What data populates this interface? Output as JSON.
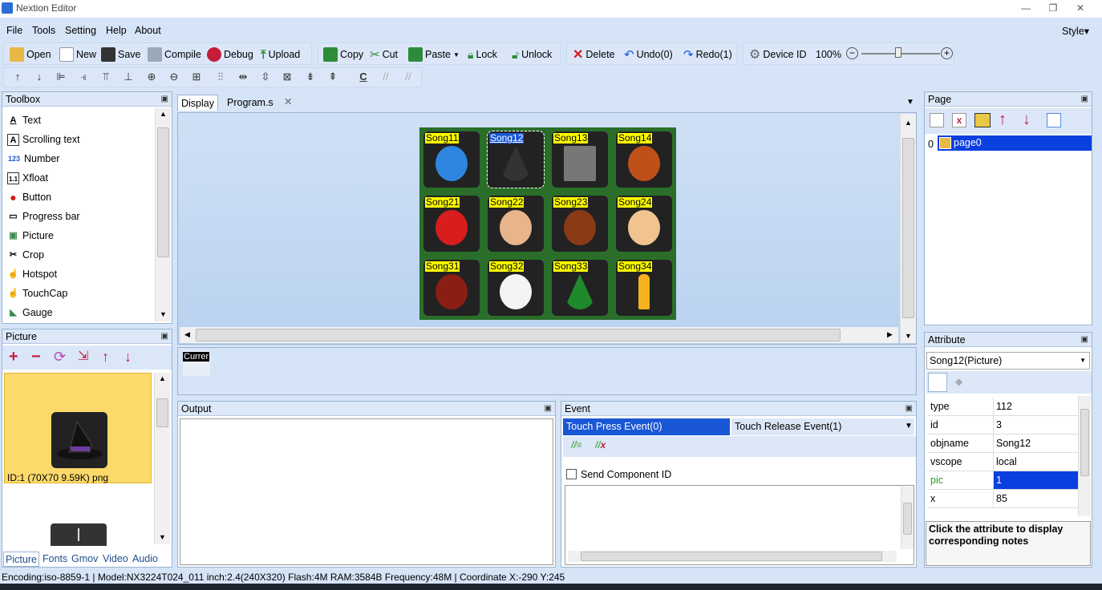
{
  "window": {
    "title": "Nextion Editor",
    "min": "—",
    "max": "❐",
    "close": "✕"
  },
  "menu": {
    "items": [
      "File",
      "Tools",
      "Setting",
      "Help",
      "About"
    ],
    "style": "Style▾"
  },
  "toolbar": {
    "open": "Open",
    "new": "New",
    "save": "Save",
    "compile": "Compile",
    "debug": "Debug",
    "upload": "Upload",
    "copy": "Copy",
    "cut": "Cut",
    "paste": "Paste",
    "lock": "Lock",
    "unlock": "Unlock",
    "delete": "Delete",
    "undo": "Undo(0)",
    "redo": "Redo(1)",
    "device_id": "Device ID",
    "zoom": "100%"
  },
  "toolbox": {
    "title": "Toolbox",
    "items": [
      {
        "label": "Text",
        "icon": "A"
      },
      {
        "label": "Scrolling text",
        "icon": "A"
      },
      {
        "label": "Number",
        "icon": "123"
      },
      {
        "label": "Xfloat",
        "icon": "1.1"
      },
      {
        "label": "Button",
        "icon": "●"
      },
      {
        "label": "Progress bar",
        "icon": "▭"
      },
      {
        "label": "Picture",
        "icon": "▣"
      },
      {
        "label": "Crop",
        "icon": "✂"
      },
      {
        "label": "Hotspot",
        "icon": "☝"
      },
      {
        "label": "TouchCap",
        "icon": "☝"
      },
      {
        "label": "Gauge",
        "icon": "◣"
      }
    ]
  },
  "picture_panel": {
    "title": "Picture",
    "caption": "ID:1  (70X70 9.59K) png"
  },
  "bottom_tabs": [
    "Picture",
    "Fonts",
    "Gmov",
    "Video",
    "Audio"
  ],
  "editor_tabs": {
    "display": "Display",
    "program": "Program.s",
    "close": "✕"
  },
  "canvas": {
    "cells": [
      {
        "label": "Song11",
        "icon": "bird-icon",
        "color": "#2e86de"
      },
      {
        "label": "Song12",
        "icon": "witch-hat-icon",
        "color": "#333333"
      },
      {
        "label": "Song13",
        "icon": "road-icon",
        "color": "#777777"
      },
      {
        "label": "Song14",
        "icon": "maple-leaf-icon",
        "color": "#c0501a"
      },
      {
        "label": "Song21",
        "icon": "ladybug-icon",
        "color": "#d71d1d"
      },
      {
        "label": "Song22",
        "icon": "dog-icon",
        "color": "#e8b48a"
      },
      {
        "label": "Song23",
        "icon": "bug-icon",
        "color": "#8a3a14"
      },
      {
        "label": "Song24",
        "icon": "boy-icon",
        "color": "#f1c48f"
      },
      {
        "label": "Song31",
        "icon": "santa-icon",
        "color": "#8a1e14"
      },
      {
        "label": "Song32",
        "icon": "snowman-icon",
        "color": "#f4f4f4"
      },
      {
        "label": "Song33",
        "icon": "tree-icon",
        "color": "#1f8a2b"
      },
      {
        "label": "Song34",
        "icon": "candle-icon",
        "color": "#f5b21b"
      }
    ]
  },
  "current_label": "Currer",
  "output": {
    "title": "Output"
  },
  "event": {
    "title": "Event",
    "tab_press": "Touch Press Event(0)",
    "tab_release": "Touch Release Event(1)",
    "send_component_id": "Send Component ID"
  },
  "page_panel": {
    "title": "Page",
    "items": [
      {
        "index": "0",
        "name": "page0"
      }
    ]
  },
  "attribute": {
    "title": "Attribute",
    "selected": "Song12(Picture)",
    "rows": [
      {
        "k": "type",
        "v": "112"
      },
      {
        "k": "id",
        "v": "3"
      },
      {
        "k": "objname",
        "v": "Song12"
      },
      {
        "k": "vscope",
        "v": "local"
      },
      {
        "k": "pic",
        "v": "1"
      },
      {
        "k": "x",
        "v": "85"
      }
    ],
    "note": "Click the attribute to display corresponding notes"
  },
  "status": "Encoding:iso-8859-1 | Model:NX3224T024_011 inch:2.4(240X320) Flash:4M RAM:3584B Frequency:48M |    Coordinate X:-290  Y:245",
  "colors": {
    "accent": "#1a57d6",
    "canvas_bg": "#2a6e2a",
    "selection": "#0a3fe0"
  }
}
